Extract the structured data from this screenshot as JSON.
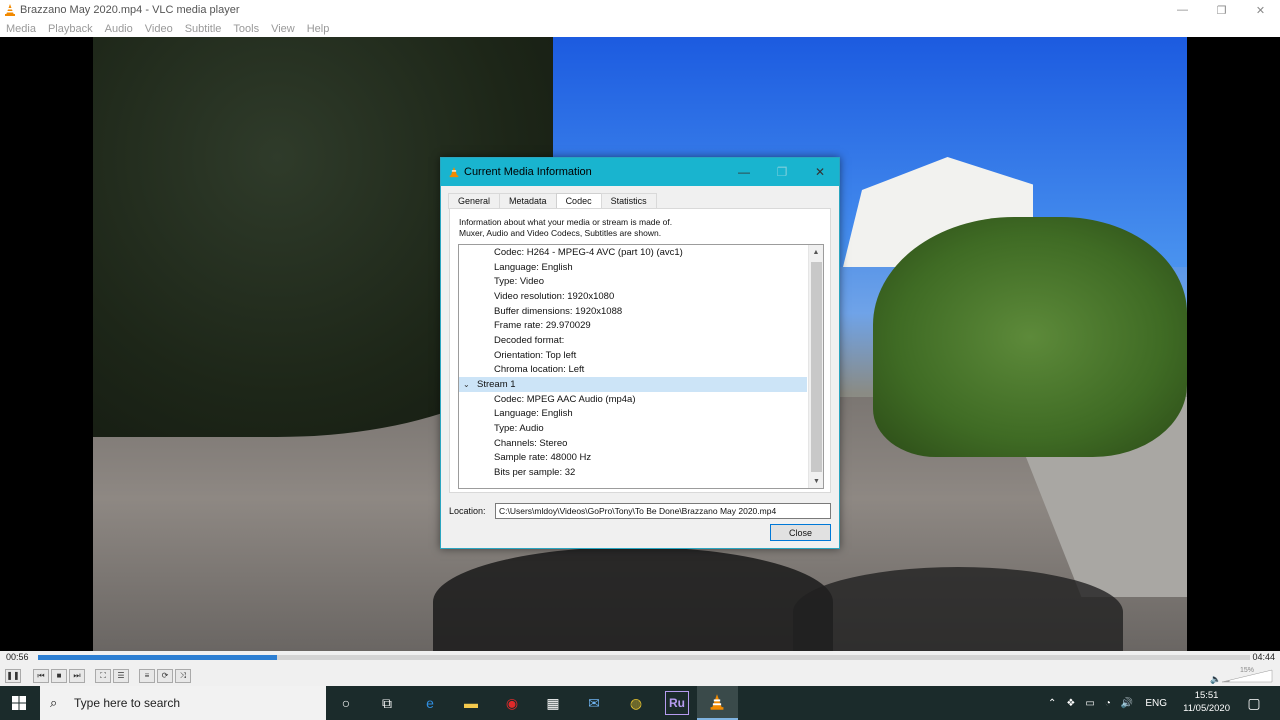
{
  "window": {
    "title": "Brazzano May 2020.mp4 - VLC media player",
    "minimize": "—",
    "maximize": "❐",
    "close": "✕"
  },
  "menu": [
    "Media",
    "Playback",
    "Audio",
    "Video",
    "Subtitle",
    "Tools",
    "View",
    "Help"
  ],
  "dialog": {
    "title": "Current Media Information",
    "tabs": [
      "General",
      "Metadata",
      "Codec",
      "Statistics"
    ],
    "active_tab": "Codec",
    "info_line1": "Information about what your media or stream is made of.",
    "info_line2": "Muxer, Audio and Video Codecs, Subtitles are shown.",
    "tree": [
      {
        "kind": "child",
        "text": "Codec: H264 - MPEG-4 AVC (part 10) (avc1)"
      },
      {
        "kind": "child",
        "text": "Language: English"
      },
      {
        "kind": "child",
        "text": "Type: Video"
      },
      {
        "kind": "child",
        "text": "Video resolution: 1920x1080"
      },
      {
        "kind": "child",
        "text": "Buffer dimensions: 1920x1088"
      },
      {
        "kind": "child",
        "text": "Frame rate: 29.970029"
      },
      {
        "kind": "child",
        "text": "Decoded format:"
      },
      {
        "kind": "child",
        "text": "Orientation: Top left"
      },
      {
        "kind": "child",
        "text": "Chroma location: Left"
      },
      {
        "kind": "parent",
        "text": "Stream 1",
        "selected": true
      },
      {
        "kind": "child",
        "text": "Codec: MPEG AAC Audio (mp4a)"
      },
      {
        "kind": "child",
        "text": "Language: English"
      },
      {
        "kind": "child",
        "text": "Type: Audio"
      },
      {
        "kind": "child",
        "text": "Channels: Stereo"
      },
      {
        "kind": "child",
        "text": "Sample rate: 48000 Hz"
      },
      {
        "kind": "child",
        "text": "Bits per sample: 32"
      }
    ],
    "location_label": "Location:",
    "location_value": "C:\\Users\\mldoy\\Videos\\GoPro\\Tony\\To Be Done\\Brazzano May 2020.mp4",
    "close_label": "Close"
  },
  "player": {
    "elapsed": "00:56",
    "total": "04:44",
    "progress_fraction": 0.197,
    "volume": "15%"
  },
  "taskbar": {
    "search_placeholder": "Type here to search",
    "language": "ENG",
    "time": "15:51",
    "date": "11/05/2020"
  },
  "colors": {
    "dialog_title": "#19b4cf",
    "progress": "#2d7fd3",
    "taskbar": "#1b2b2b",
    "vlc_orange": "#f28a00"
  }
}
